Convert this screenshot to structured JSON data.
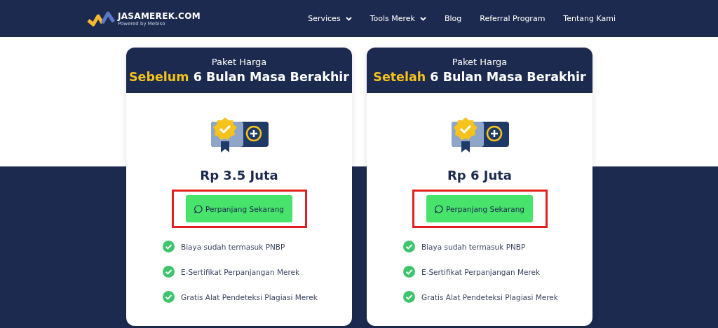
{
  "header": {
    "logo": {
      "name": "JASAMEREK.COM",
      "tagline": "Powered by Mebiso"
    },
    "nav": [
      {
        "label": "Services",
        "dropdown": true
      },
      {
        "label": "Tools Merek",
        "dropdown": true
      },
      {
        "label": "Blog",
        "dropdown": false
      },
      {
        "label": "Referral Program",
        "dropdown": false
      },
      {
        "label": "Tentang Kami",
        "dropdown": false
      }
    ]
  },
  "cards": [
    {
      "subtitle": "Paket Harga",
      "title_highlight": "Sebelum",
      "title_rest": "6 Bulan Masa Berakhir",
      "price": "Rp 3.5 Juta",
      "button": "Perpanjang Sekarang",
      "highlighted": true,
      "features": [
        "Biaya sudah termasuk PNBP",
        "E-Sertifikat Perpanjangan Merek",
        "Gratis Alat Pendeteksi Plagiasi Merek"
      ]
    },
    {
      "subtitle": "Paket Harga",
      "title_highlight": "Setelah",
      "title_rest": "6 Bulan Masa Berakhir",
      "price": "Rp 6 Juta",
      "button": "Perpanjang Sekarang",
      "highlighted": true,
      "features": [
        "Biaya sudah termasuk PNBP",
        "E-Sertifikat Perpanjangan Merek",
        "Gratis Alat Pendeteksi Plagiasi Merek"
      ]
    }
  ]
}
